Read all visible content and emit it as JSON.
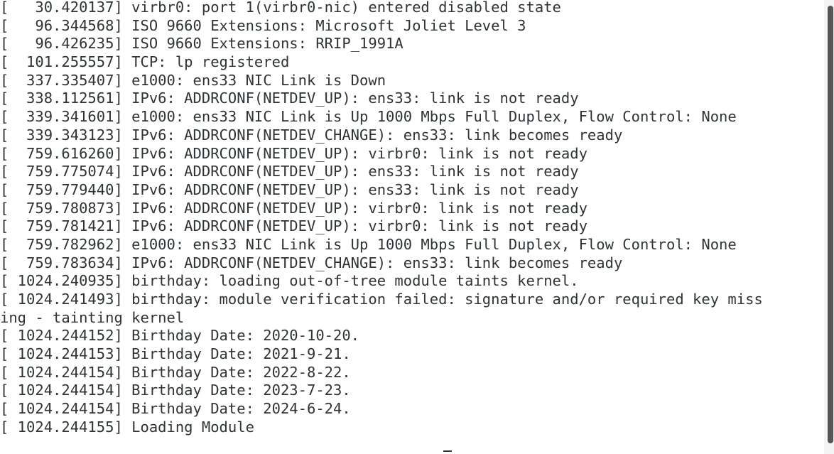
{
  "terminal": {
    "lines": [
      "[   30.420137] virbr0: port 1(virbr0-nic) entered disabled state",
      "[   96.344568] ISO 9660 Extensions: Microsoft Joliet Level 3",
      "[   96.426235] ISO 9660 Extensions: RRIP_1991A",
      "[  101.255557] TCP: lp registered",
      "[  337.335407] e1000: ens33 NIC Link is Down",
      "[  338.112561] IPv6: ADDRCONF(NETDEV_UP): ens33: link is not ready",
      "[  339.341601] e1000: ens33 NIC Link is Up 1000 Mbps Full Duplex, Flow Control: None",
      "[  339.343123] IPv6: ADDRCONF(NETDEV_CHANGE): ens33: link becomes ready",
      "[  759.616260] IPv6: ADDRCONF(NETDEV_UP): virbr0: link is not ready",
      "[  759.775074] IPv6: ADDRCONF(NETDEV_UP): ens33: link is not ready",
      "[  759.779440] IPv6: ADDRCONF(NETDEV_UP): ens33: link is not ready",
      "[  759.780873] IPv6: ADDRCONF(NETDEV_UP): virbr0: link is not ready",
      "[  759.781421] IPv6: ADDRCONF(NETDEV_UP): virbr0: link is not ready",
      "[  759.782962] e1000: ens33 NIC Link is Up 1000 Mbps Full Duplex, Flow Control: None",
      "[  759.783634] IPv6: ADDRCONF(NETDEV_CHANGE): ens33: link becomes ready",
      "[ 1024.240935] birthday: loading out-of-tree module taints kernel.",
      "[ 1024.241493] birthday: module verification failed: signature and/or required key miss",
      "ing - tainting kernel",
      "[ 1024.244152] Birthday Date: 2020-10-20.",
      "[ 1024.244153] Birthday Date: 2021-9-21.",
      "[ 1024.244154] Birthday Date: 2022-8-22.",
      "[ 1024.244154] Birthday Date: 2023-7-23.",
      "[ 1024.244154] Birthday Date: 2024-6-24.",
      "[ 1024.244155] Loading Module"
    ]
  },
  "colors": {
    "background": "#ffffff",
    "text": "#2e3436",
    "scroll_thumb": "#555555"
  }
}
